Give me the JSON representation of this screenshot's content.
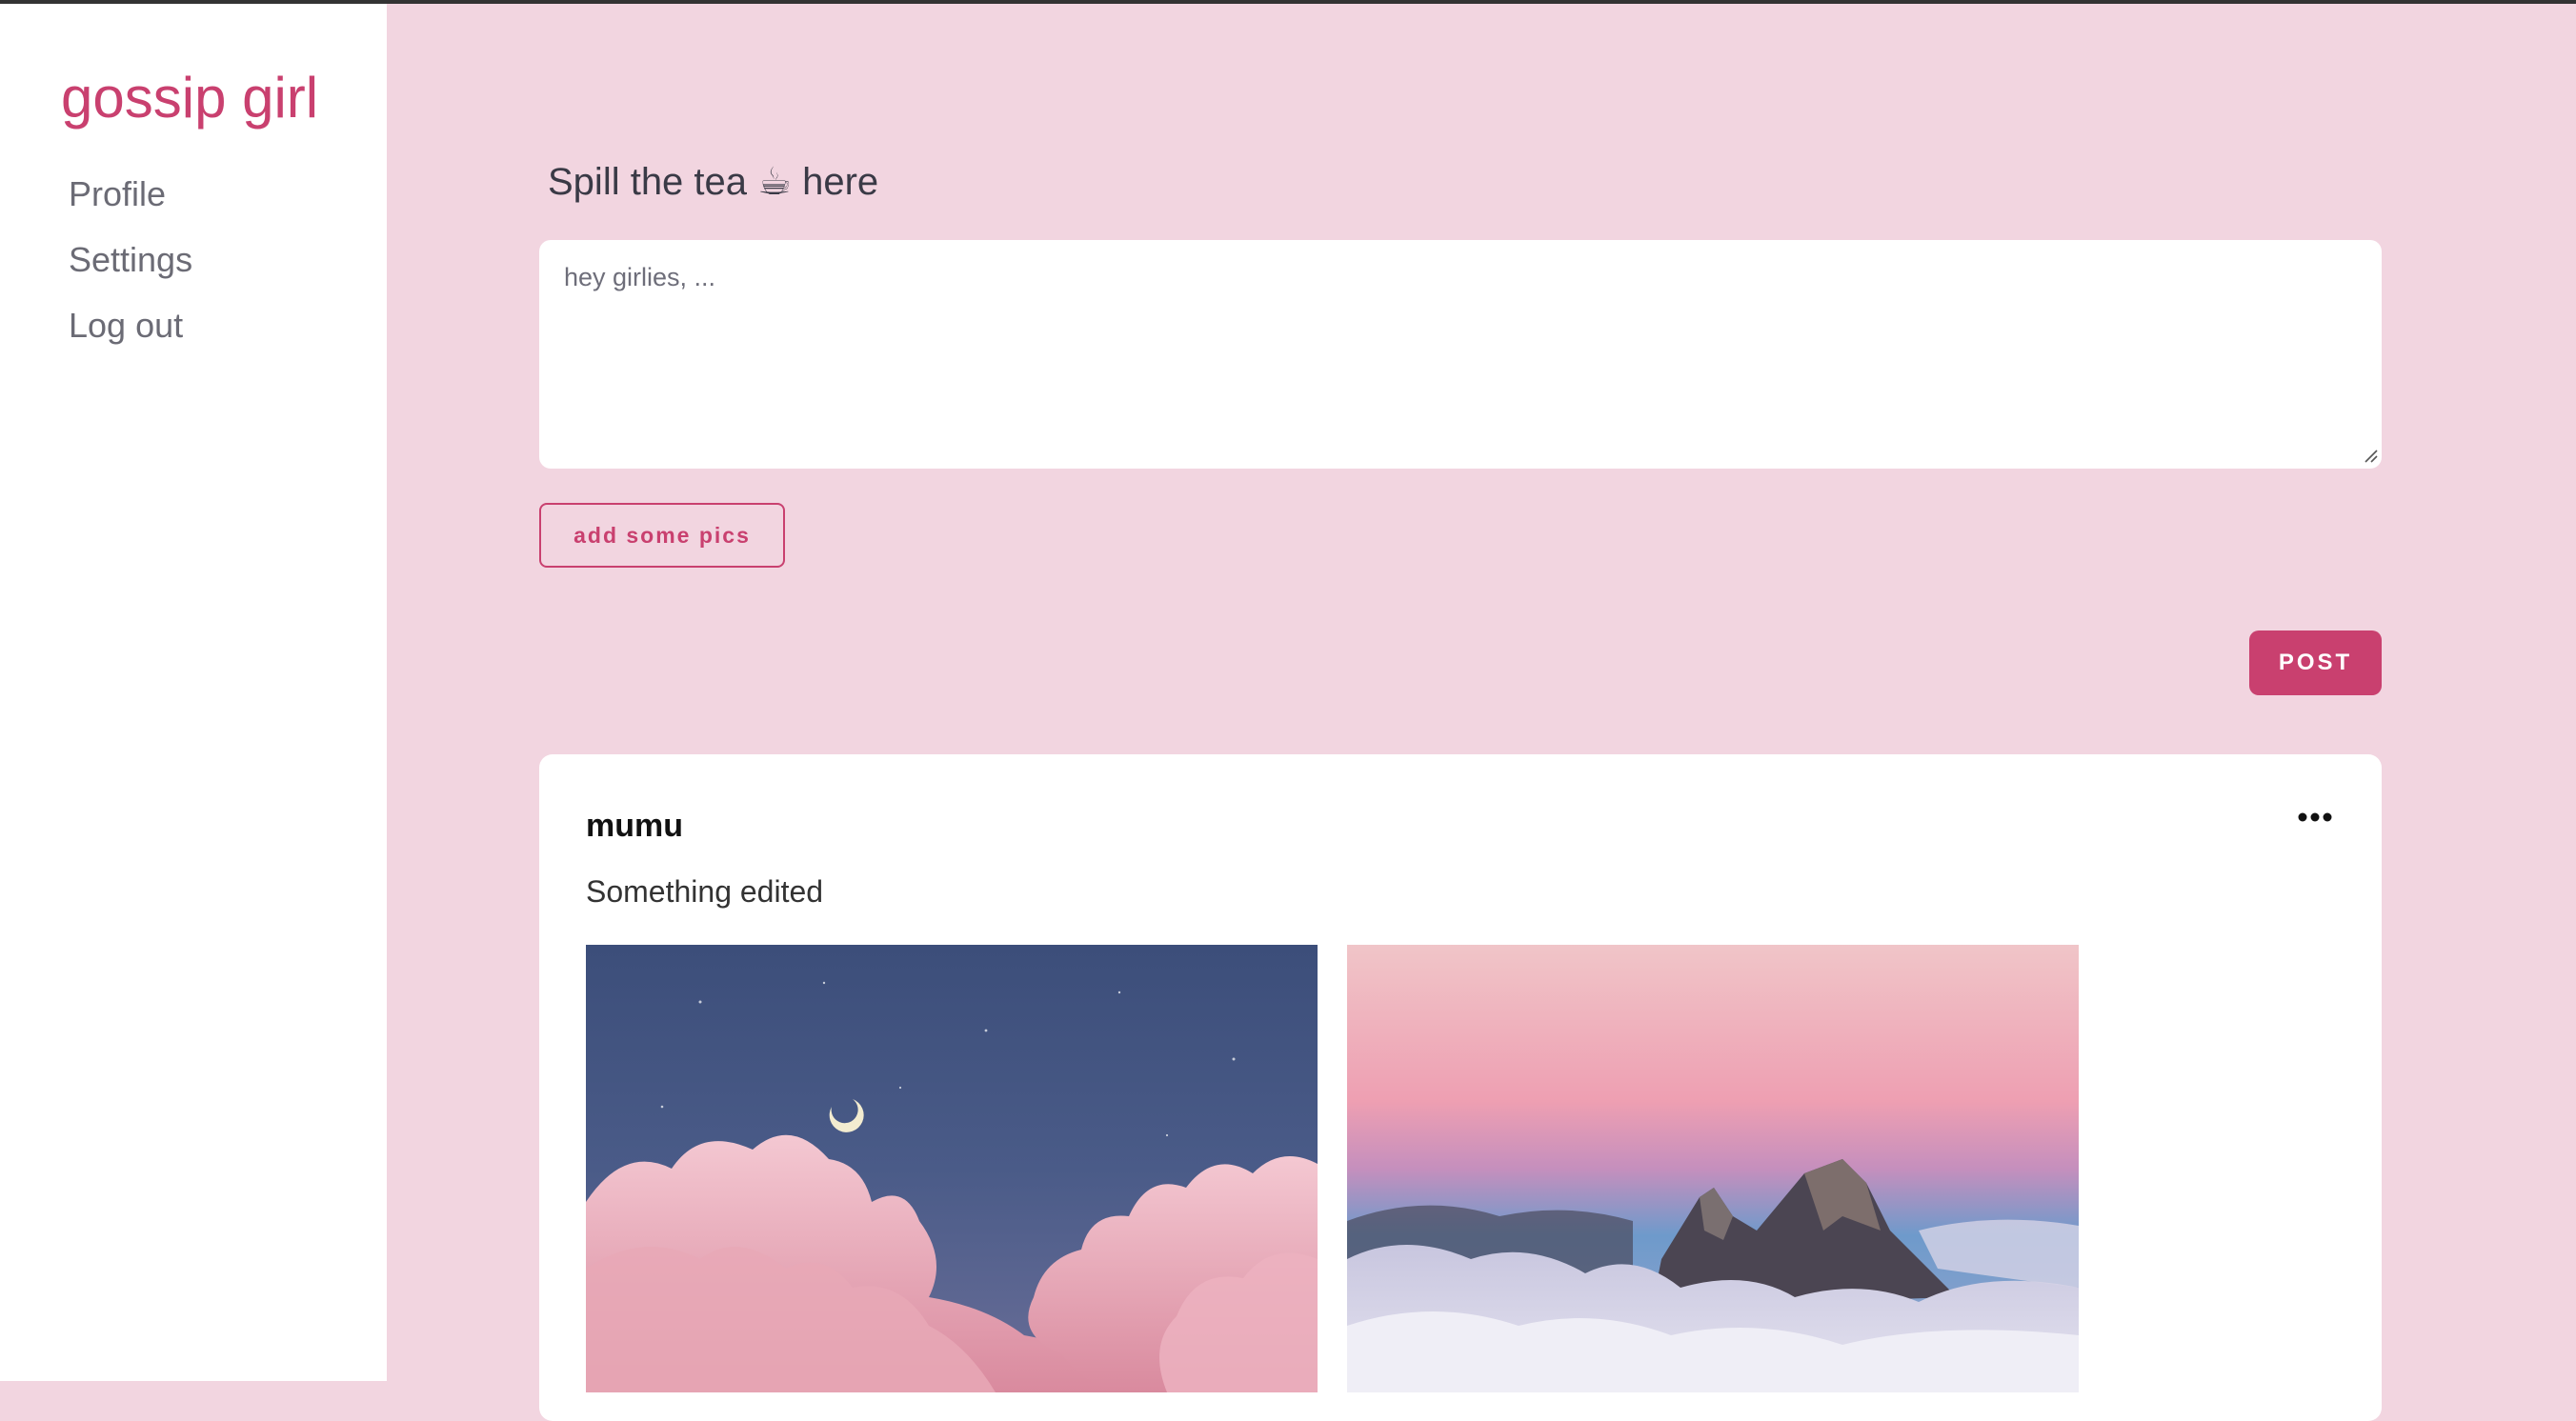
{
  "sidebar": {
    "brand": "gossip girl",
    "items": [
      {
        "label": "Profile"
      },
      {
        "label": "Settings"
      },
      {
        "label": "Log out"
      }
    ]
  },
  "compose": {
    "heading": "Spill the tea ☕ here",
    "placeholder": "hey girlies, ...",
    "add_pics_label": "add some pics",
    "post_label": "POST"
  },
  "post": {
    "author": "mumu",
    "text": "Something edited",
    "more_icon": "ellipsis-icon",
    "images": [
      {
        "alt": "night-sky-pink-clouds"
      },
      {
        "alt": "mountain-peaks-above-clouds"
      }
    ]
  },
  "colors": {
    "accent": "#c9406f",
    "background": "#f2d5e0",
    "sidebar": "#ffffff"
  }
}
